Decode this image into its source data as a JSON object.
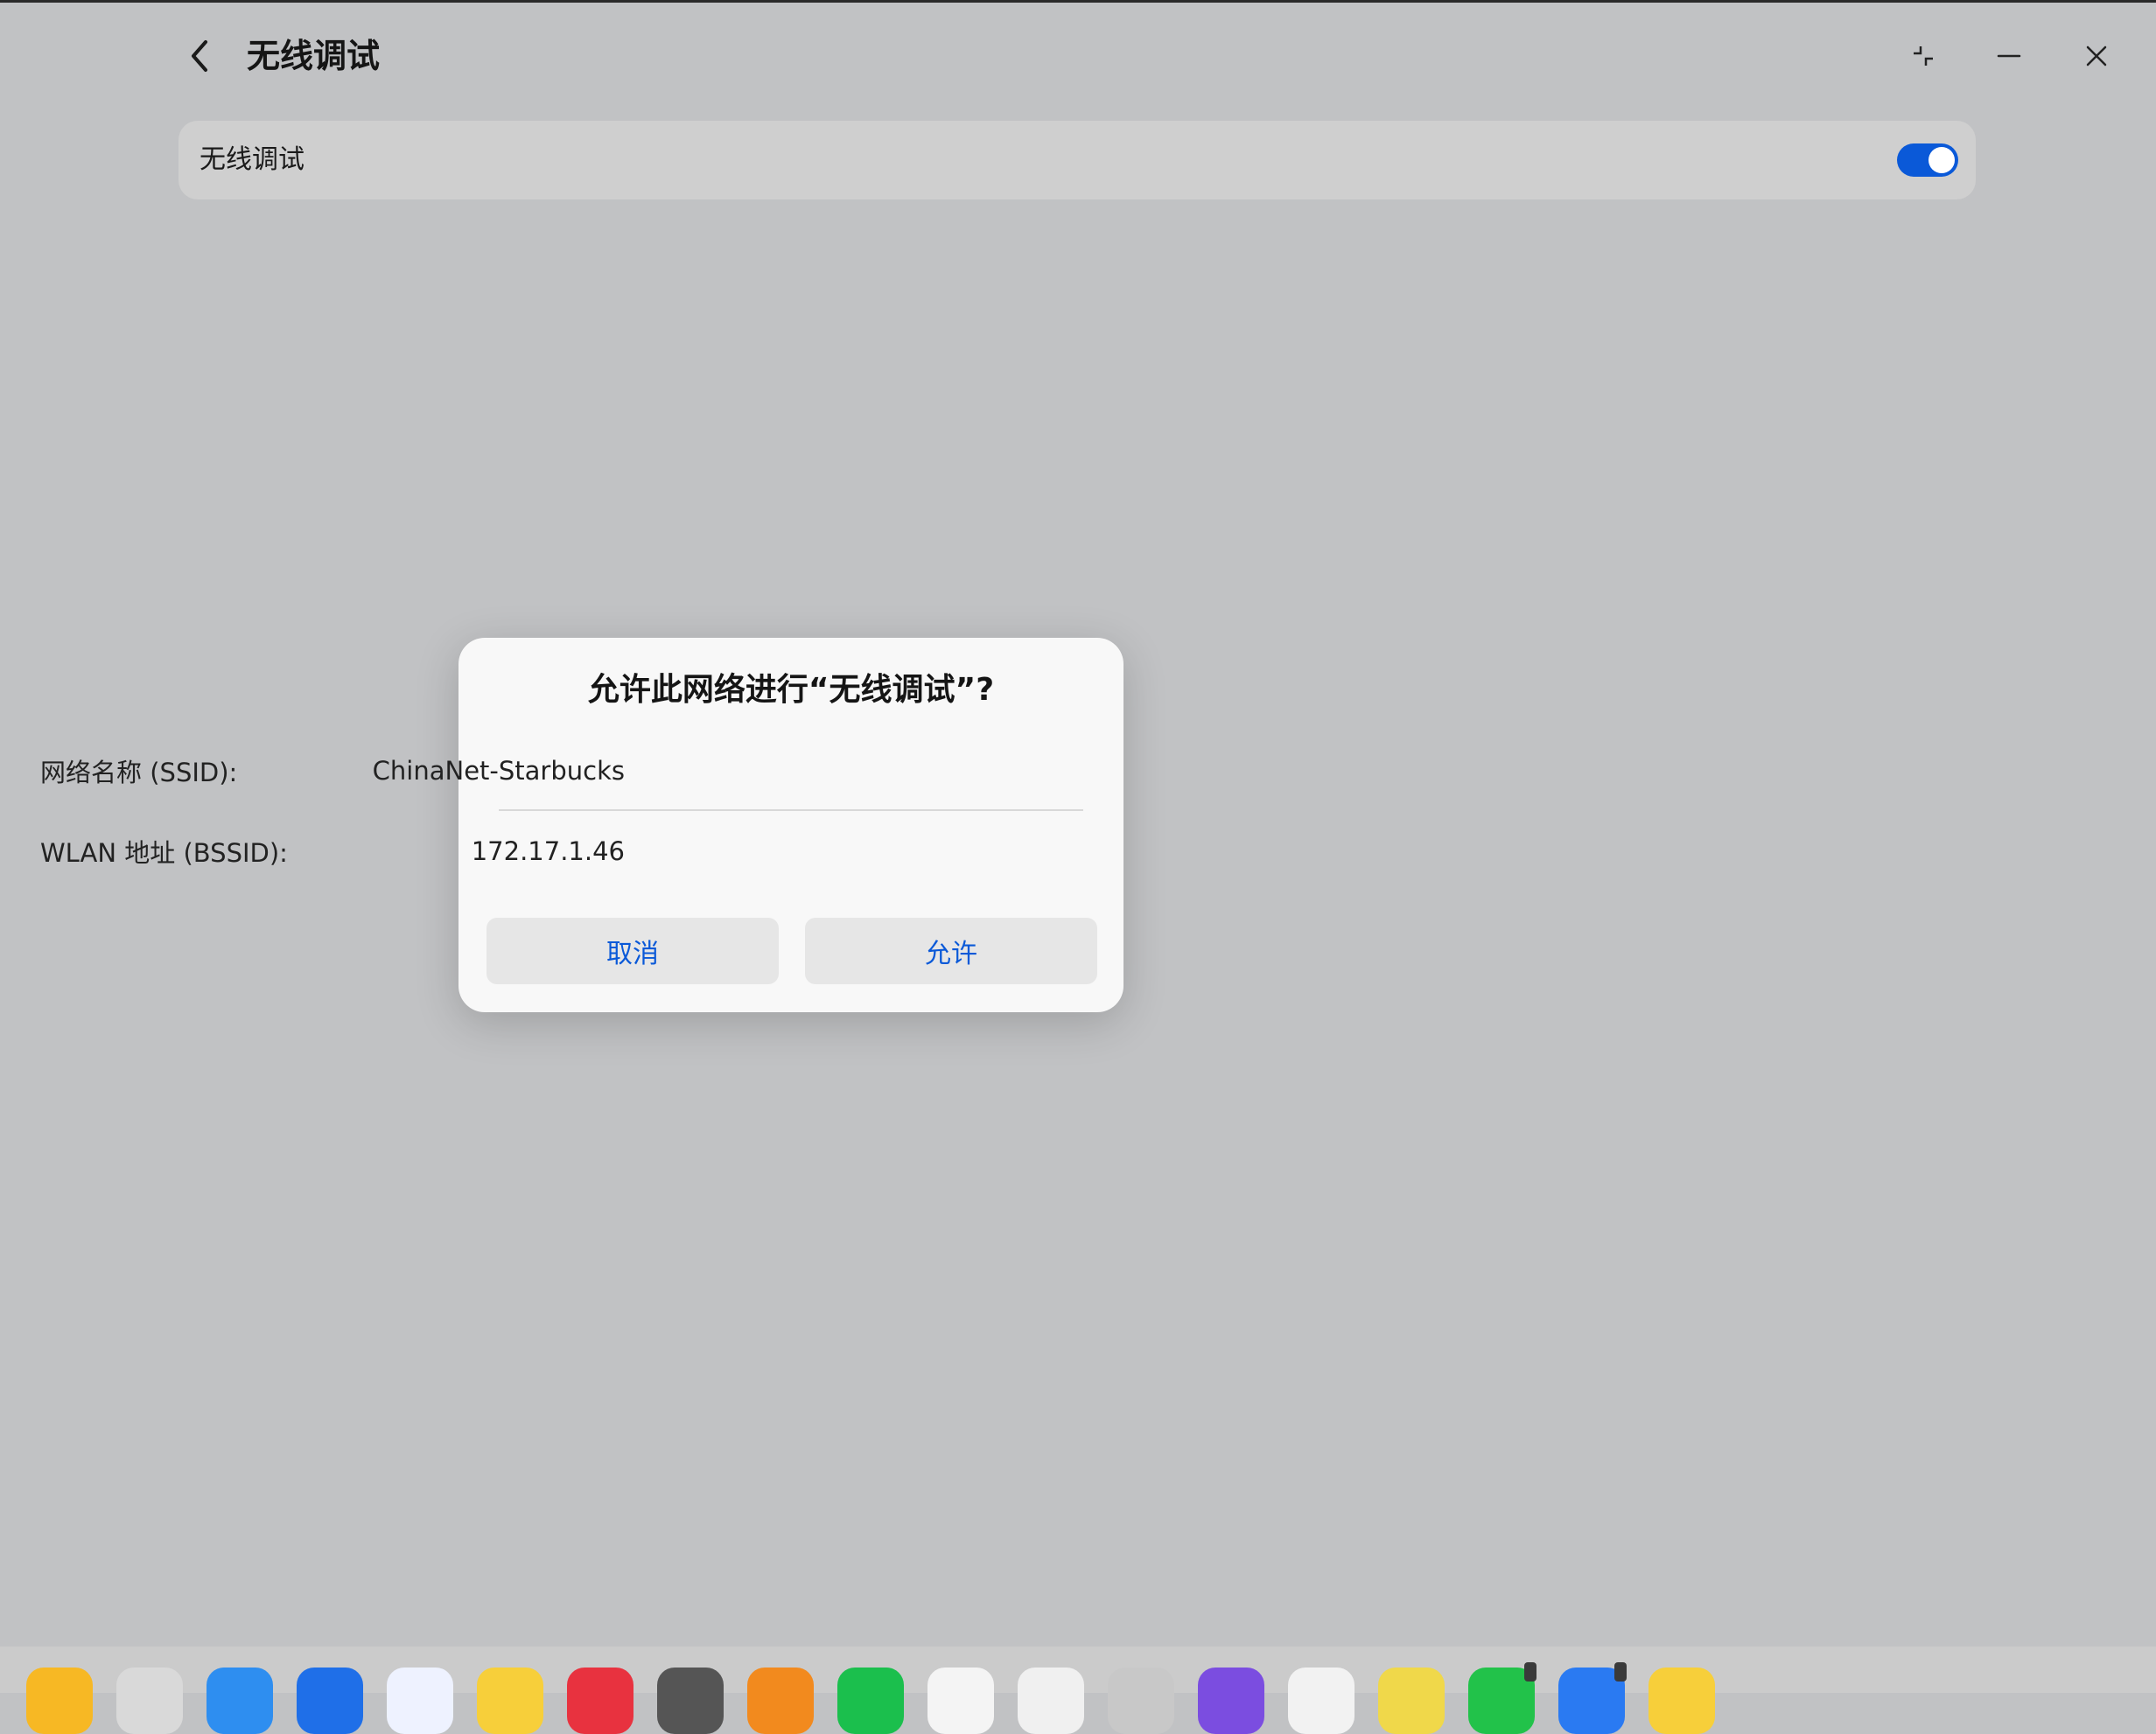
{
  "header": {
    "title": "无线调试"
  },
  "setting": {
    "label": "无线调试",
    "enabled": true,
    "accent_color": "#0a59d8"
  },
  "dialog": {
    "title": "允许此网络进行“无线调试”?",
    "ssid_label": "网络名称 (SSID):",
    "ssid_value": "ChinaNet-Starbucks",
    "bssid_label": "WLAN 地址 (BSSID):",
    "bssid_value": "172.17.1.46",
    "cancel_label": "取消",
    "allow_label": "允许"
  },
  "dock": {
    "apps": [
      {
        "name": "notes-app-icon",
        "color": "#f7b824"
      },
      {
        "name": "trash-app-icon",
        "color": "#d9d9d9"
      },
      {
        "name": "browser-app-icon",
        "color": "#2e8ef0"
      },
      {
        "name": "mail-app-icon",
        "color": "#1f6fe8"
      },
      {
        "name": "gallery-app-icon",
        "color": "#eef2ff"
      },
      {
        "name": "memo-app-icon",
        "color": "#f7cf3a"
      },
      {
        "name": "store-app-icon",
        "color": "#e8323f"
      },
      {
        "name": "settings-app-icon",
        "color": "#555555"
      },
      {
        "name": "office-app-icon",
        "color": "#f28a1e"
      },
      {
        "name": "wechat-app-icon",
        "color": "#1bbf4d"
      },
      {
        "name": "qq-app-icon",
        "color": "#f4f4f4"
      },
      {
        "name": "wps-app-icon",
        "color": "#f0f0f0"
      },
      {
        "name": "color-app-icon",
        "color": "#c8c8c8"
      },
      {
        "name": "assistant-app-icon",
        "color": "#7b4de0"
      },
      {
        "name": "game-app-icon",
        "color": "#f2f2f2"
      },
      {
        "name": "pinwheel-app-icon",
        "color": "#f0d84a"
      },
      {
        "name": "phone-app-icon",
        "color": "#22c24a"
      },
      {
        "name": "messages-app-icon",
        "color": "#2a7af2"
      },
      {
        "name": "x-app-icon",
        "color": "#f7cf3a"
      }
    ]
  }
}
